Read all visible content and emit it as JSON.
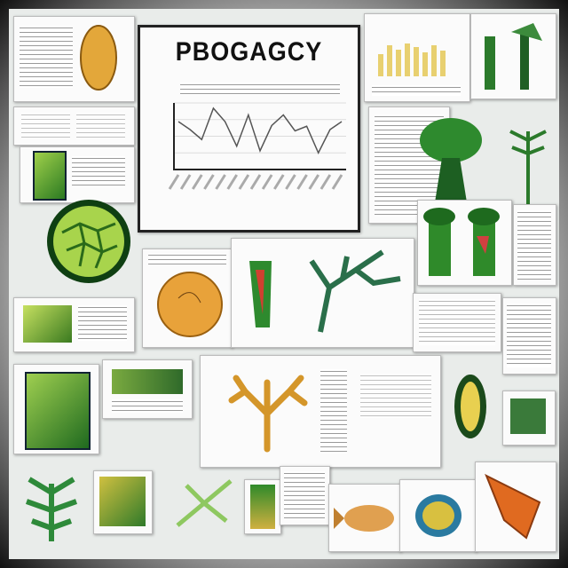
{
  "poster": {
    "title": "PBOGAGCY"
  },
  "main_chart": {
    "values": [
      0.72,
      0.6,
      0.45,
      0.92,
      0.72,
      0.35,
      0.82,
      0.28,
      0.66,
      0.82,
      0.58,
      0.65,
      0.25,
      0.6,
      0.72
    ]
  },
  "colors": {
    "leaf_green": "#2f8a2a",
    "dark_green": "#135e1a",
    "orange": "#e8a23a",
    "border": "#1a1a1a"
  }
}
